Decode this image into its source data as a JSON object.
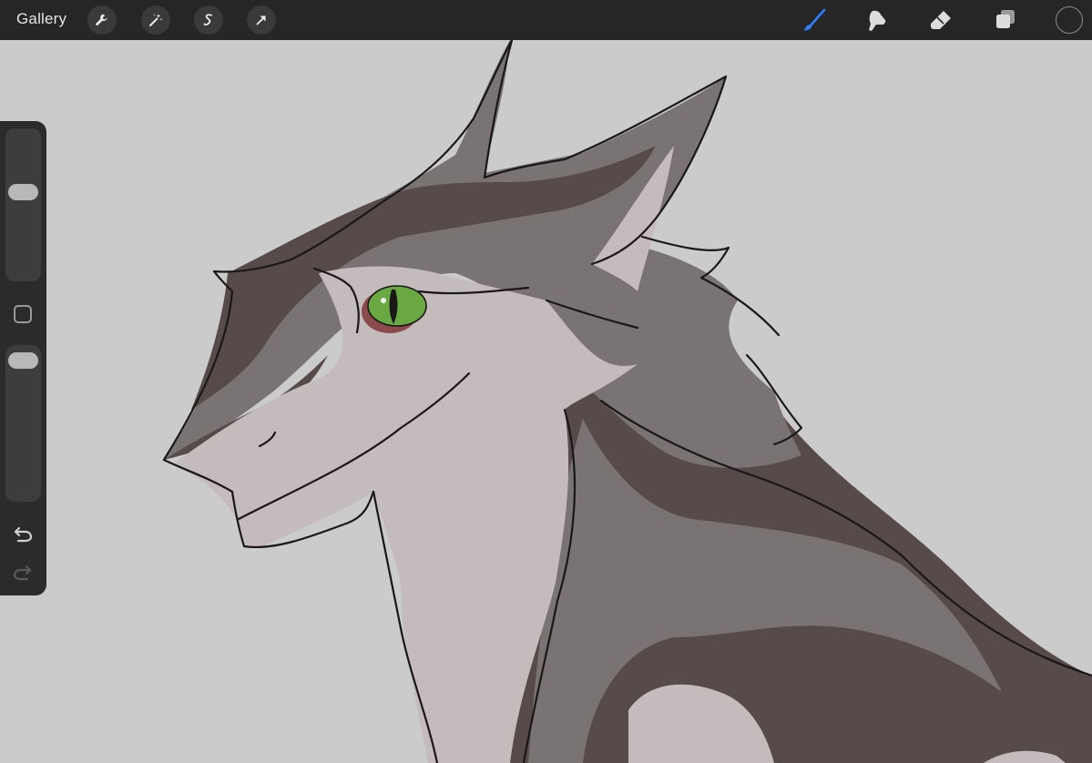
{
  "app": {
    "gallery_label": "Gallery"
  },
  "toolbar": {
    "left_tools": [
      {
        "icon": "wrench-icon",
        "name": "actions"
      },
      {
        "icon": "magic-wand-icon",
        "name": "adjustments"
      },
      {
        "icon": "selection-s-icon",
        "name": "selection"
      },
      {
        "icon": "transform-arrow-icon",
        "name": "transform"
      }
    ],
    "right_tools": [
      {
        "icon": "brush-icon",
        "name": "paint",
        "active": true
      },
      {
        "icon": "smudge-icon",
        "name": "smudge",
        "active": false
      },
      {
        "icon": "eraser-icon",
        "name": "eraser",
        "active": false
      },
      {
        "icon": "layers-icon",
        "name": "layers",
        "active": false
      }
    ],
    "active_color": "#2f7cf6",
    "current_color": "#262626"
  },
  "sidebar": {
    "brush_size_level": 0.42,
    "opacity_level": 0.05,
    "undo_icon": "undo-icon",
    "redo_icon": "redo-icon"
  },
  "colors": {
    "canvas_bg": "#cbcbcb",
    "fur_dark": "#564b4a",
    "fur_mid": "#797373",
    "fur_light": "#c3bbbc",
    "eye_green": "#6aa842",
    "line": "#1a1718"
  }
}
